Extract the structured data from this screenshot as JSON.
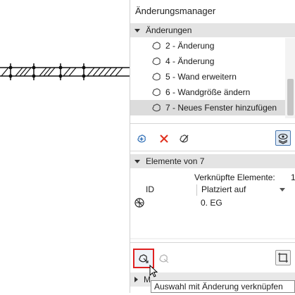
{
  "panel": {
    "title": "Änderungsmanager",
    "changes_section": {
      "title": "Änderungen"
    },
    "changes": [
      {
        "label": "2 - Änderung",
        "selected": false
      },
      {
        "label": "4 - Änderung",
        "selected": false
      },
      {
        "label": "5 - Wand erweitern",
        "selected": false
      },
      {
        "label": "6 - Wandgröße ändern",
        "selected": false
      },
      {
        "label": "7 - Neues Fenster hinzufügen",
        "selected": true
      }
    ],
    "elements_section": {
      "title": "Elemente von 7"
    },
    "linked_elements": {
      "label": "Verknüpfte Elemente:",
      "count": "1"
    },
    "columns": {
      "id": "ID",
      "placed_on": "Platziert auf"
    },
    "rows": [
      {
        "id": "",
        "placed_on": "0. EG"
      }
    ],
    "collapsed_section": {
      "title": "M"
    },
    "tooltip": "Auswahl mit Änderung verknüpfen",
    "colors": {
      "accent": "#e02020",
      "selected_row": "#dcdcdc",
      "delete_x": "#e0301e"
    }
  }
}
